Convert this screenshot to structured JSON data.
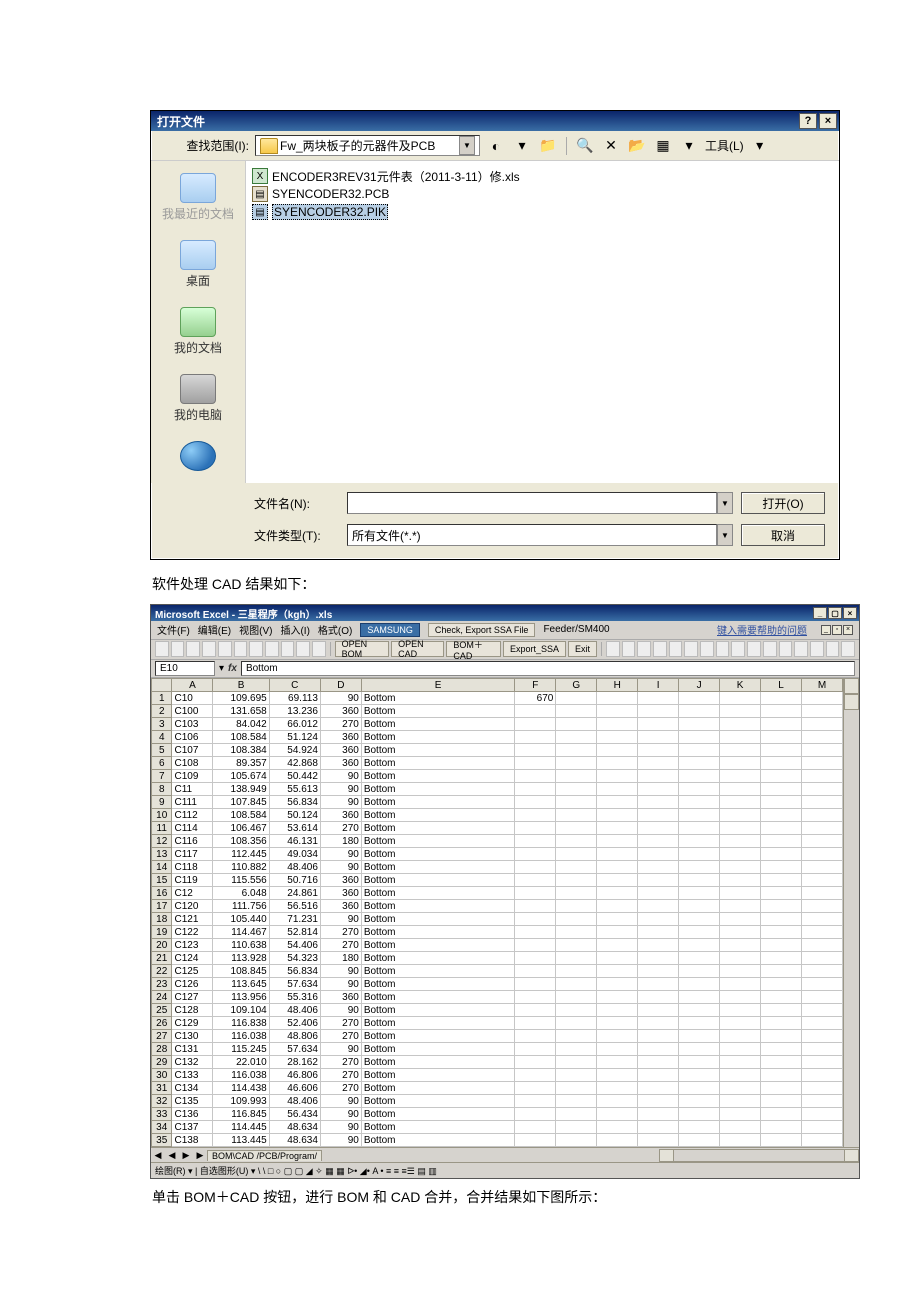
{
  "dialog": {
    "title": "打开文件",
    "look_in_label": "查找范围(I):",
    "look_in_value": "Fw_两块板子的元器件及PCB",
    "tools_label": "工具(L)",
    "files": [
      {
        "name": "ENCODER3REV31元件表（2011-3-11）修.xls",
        "type": "xls"
      },
      {
        "name": "SYENCODER32.PCB",
        "type": "pcb"
      },
      {
        "name": "SYENCODER32.PIK",
        "type": "pik"
      }
    ],
    "places": {
      "recent": "我最近的文档",
      "desktop": "桌面",
      "mydocs": "我的文档",
      "mycomp": "我的电脑"
    },
    "filename_label": "文件名(N):",
    "filetype_label": "文件类型(T):",
    "filetype_value": "所有文件(*.*)",
    "open_btn": "打开(O)",
    "cancel_btn": "取消",
    "help_glyph": "?",
    "close_glyph": "×",
    "dd_glyph": "▼"
  },
  "caption1": "软件处理 CAD 结果如下：",
  "caption2": "单击 BOM＋CAD 按钮，进行 BOM 和 CAD 合并，合并结果如下图所示：",
  "excel": {
    "title": "Microsoft Excel - 三星程序（kgh）.xls",
    "menu": {
      "file": "文件(F)",
      "edit": "编辑(E)",
      "view": "视图(V)",
      "insert": "插入(I)",
      "format": "格式(O)",
      "samsung": "SAMSUNG",
      "check_export": "Check, Export SSA File",
      "feeder": "Feeder/SM400",
      "help": "键入需要帮助的问题"
    },
    "tool_btns": {
      "open_bom": "OPEN BOM",
      "open_cad": "OPEN CAD",
      "bom_cad": "BOM＋CAD",
      "export_ssa": "Export_SSA",
      "exit": "Exit"
    },
    "namebox": "E10",
    "fx_value": "Bottom",
    "columns": [
      "",
      "A",
      "B",
      "C",
      "D",
      "E",
      "F",
      "G",
      "H",
      "I",
      "J",
      "K",
      "L",
      "M"
    ],
    "dvalue": "670",
    "rows": [
      [
        "1",
        "C10",
        "109.695",
        "69.113",
        "90",
        "Bottom"
      ],
      [
        "2",
        "C100",
        "131.658",
        "13.236",
        "360",
        "Bottom"
      ],
      [
        "3",
        "C103",
        "84.042",
        "66.012",
        "270",
        "Bottom"
      ],
      [
        "4",
        "C106",
        "108.584",
        "51.124",
        "360",
        "Bottom"
      ],
      [
        "5",
        "C107",
        "108.384",
        "54.924",
        "360",
        "Bottom"
      ],
      [
        "6",
        "C108",
        "89.357",
        "42.868",
        "360",
        "Bottom"
      ],
      [
        "7",
        "C109",
        "105.674",
        "50.442",
        "90",
        "Bottom"
      ],
      [
        "8",
        "C11",
        "138.949",
        "55.613",
        "90",
        "Bottom"
      ],
      [
        "9",
        "C111",
        "107.845",
        "56.834",
        "90",
        "Bottom"
      ],
      [
        "10",
        "C112",
        "108.584",
        "50.124",
        "360",
        "Bottom"
      ],
      [
        "11",
        "C114",
        "106.467",
        "53.614",
        "270",
        "Bottom"
      ],
      [
        "12",
        "C116",
        "108.356",
        "46.131",
        "180",
        "Bottom"
      ],
      [
        "13",
        "C117",
        "112.445",
        "49.034",
        "90",
        "Bottom"
      ],
      [
        "14",
        "C118",
        "110.882",
        "48.406",
        "90",
        "Bottom"
      ],
      [
        "15",
        "C119",
        "115.556",
        "50.716",
        "360",
        "Bottom"
      ],
      [
        "16",
        "C12",
        "6.048",
        "24.861",
        "360",
        "Bottom"
      ],
      [
        "17",
        "C120",
        "111.756",
        "56.516",
        "360",
        "Bottom"
      ],
      [
        "18",
        "C121",
        "105.440",
        "71.231",
        "90",
        "Bottom"
      ],
      [
        "19",
        "C122",
        "114.467",
        "52.814",
        "270",
        "Bottom"
      ],
      [
        "20",
        "C123",
        "110.638",
        "54.406",
        "270",
        "Bottom"
      ],
      [
        "21",
        "C124",
        "113.928",
        "54.323",
        "180",
        "Bottom"
      ],
      [
        "22",
        "C125",
        "108.845",
        "56.834",
        "90",
        "Bottom"
      ],
      [
        "23",
        "C126",
        "113.645",
        "57.634",
        "90",
        "Bottom"
      ],
      [
        "24",
        "C127",
        "113.956",
        "55.316",
        "360",
        "Bottom"
      ],
      [
        "25",
        "C128",
        "109.104",
        "48.406",
        "90",
        "Bottom"
      ],
      [
        "26",
        "C129",
        "116.838",
        "52.406",
        "270",
        "Bottom"
      ],
      [
        "27",
        "C130",
        "116.038",
        "48.806",
        "270",
        "Bottom"
      ],
      [
        "28",
        "C131",
        "115.245",
        "57.634",
        "90",
        "Bottom"
      ],
      [
        "29",
        "C132",
        "22.010",
        "28.162",
        "270",
        "Bottom"
      ],
      [
        "30",
        "C133",
        "116.038",
        "46.806",
        "270",
        "Bottom"
      ],
      [
        "31",
        "C134",
        "114.438",
        "46.606",
        "270",
        "Bottom"
      ],
      [
        "32",
        "C135",
        "109.993",
        "48.406",
        "90",
        "Bottom"
      ],
      [
        "33",
        "C136",
        "116.845",
        "56.434",
        "90",
        "Bottom"
      ],
      [
        "34",
        "C137",
        "114.445",
        "48.634",
        "90",
        "Bottom"
      ],
      [
        "35",
        "C138",
        "113.445",
        "48.634",
        "90",
        "Bottom"
      ]
    ],
    "sheets": {
      "nav": "◀ ◀ ▶ ▶",
      "label": "BOM\\CAD /PCB/Program/"
    },
    "drawbar": "绘图(R) ▾  | 自选图形(U) ▾  \\  \\  □ ○ ▢ ▢ ◢ ✧ ▦ ▦  ᐅ• ◢• A • ≡ ≡ ≡☰ ▤ ▥"
  }
}
